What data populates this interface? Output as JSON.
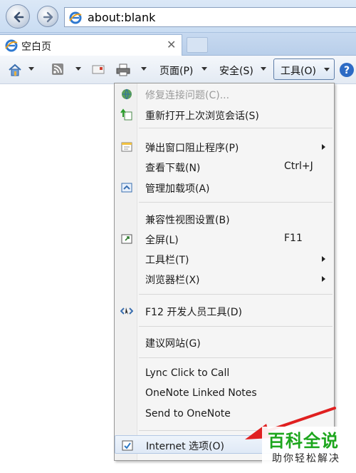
{
  "address_bar": {
    "url": "about:blank"
  },
  "tab": {
    "title": "空白页",
    "close": "✕"
  },
  "command_bar": {
    "page_label": "页面(P)",
    "safety_label": "安全(S)",
    "tools_label": "工具(O)"
  },
  "menu": {
    "items": [
      {
        "label": "修复连接问题(C)...",
        "disabled": true
      },
      {
        "label": "重新打开上次浏览会话(S)"
      },
      {
        "label": "弹出窗口阻止程序(P)"
      },
      {
        "label": "查看下载(N)",
        "shortcut": "Ctrl+J"
      },
      {
        "label": "管理加载项(A)"
      },
      {
        "label": "兼容性视图设置(B)"
      },
      {
        "label": "全屏(L)",
        "shortcut": "F11"
      },
      {
        "label": "工具栏(T)"
      },
      {
        "label": "浏览器栏(X)"
      },
      {
        "label": "F12 开发人员工具(D)"
      },
      {
        "label": "建议网站(G)"
      },
      {
        "label": "Lync Click to Call"
      },
      {
        "label": "OneNote Linked Notes"
      },
      {
        "label": "Send to OneNote"
      },
      {
        "label": "Internet 选项(O)"
      }
    ]
  },
  "watermark": {
    "title": "百科全说",
    "subtitle": "助你轻松解决"
  },
  "colors": {
    "accent": "#1e5aa8",
    "arrow": "#e02020",
    "watermark_green": "#1da61d"
  }
}
